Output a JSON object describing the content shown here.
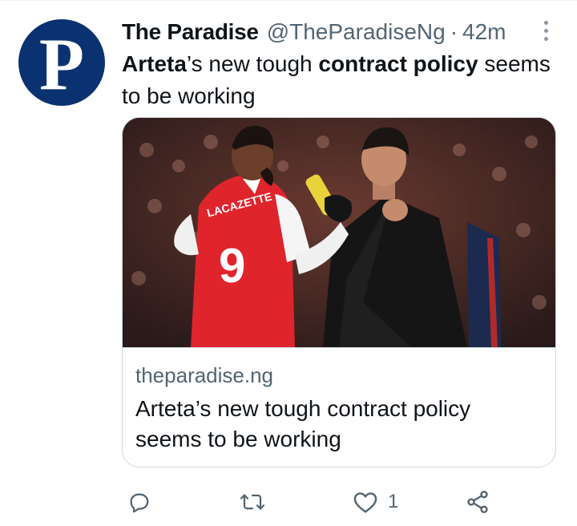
{
  "avatar": {
    "letter": "P",
    "color": "#0a3270"
  },
  "tweet": {
    "display_name": "The Paradise",
    "handle": "@TheParadiseNg",
    "separator": "·",
    "time": "42m",
    "text": {
      "part1_bold": "Arteta",
      "part2": "’s new tough ",
      "part3_bold": "contract policy",
      "part4": " seems to be working"
    }
  },
  "card": {
    "image_icon": "football-photo",
    "domain": "theparadise.ng",
    "title": "Arteta’s new tough contract policy seems to be working",
    "jersey_name": "LACAZETTE",
    "jersey_number": "9"
  },
  "actions": {
    "reply_icon": "reply-icon",
    "retweet_icon": "retweet-icon",
    "like_icon": "heart-icon",
    "like_count": "1",
    "share_icon": "share-icon"
  },
  "colors": {
    "text": "#0f1419",
    "secondary": "#536471",
    "border": "#cfd9de"
  }
}
